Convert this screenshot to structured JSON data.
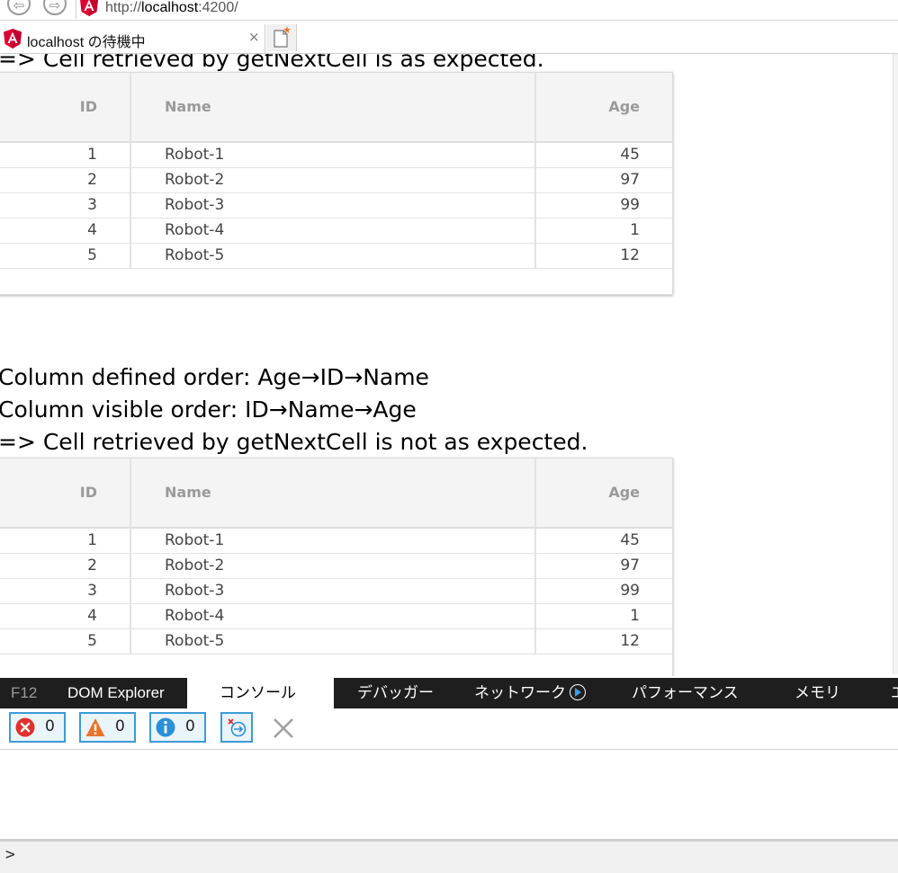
{
  "browser": {
    "url_prefix": "http://",
    "url_host": "localhost",
    "url_suffix": ":4200/",
    "tab_title": "localhost の待機中",
    "tab_close": "×"
  },
  "section1": {
    "partial_line": "=> Cell retrieved by getNextCell is as expected."
  },
  "section2": {
    "line1": "Column defined order: Age→ID→Name",
    "line2": "Column visible order: ID→Name→Age",
    "line3": "=> Cell retrieved by getNextCell is not as expected."
  },
  "grid": {
    "columns": [
      "ID",
      "Name",
      "Age"
    ],
    "rows": [
      {
        "id": "1",
        "name": "Robot-1",
        "age": "45"
      },
      {
        "id": "2",
        "name": "Robot-2",
        "age": "97"
      },
      {
        "id": "3",
        "name": "Robot-3",
        "age": "99"
      },
      {
        "id": "4",
        "name": "Robot-4",
        "age": "1"
      },
      {
        "id": "5",
        "name": "Robot-5",
        "age": "12"
      }
    ]
  },
  "devtools": {
    "tabs": [
      "F12",
      "DOM Explorer",
      "コンソール",
      "デバッガー",
      "ネットワーク",
      "パフォーマンス",
      "メモリ",
      "エ"
    ],
    "active_tab": "コンソール",
    "errors": "0",
    "warnings": "0",
    "info": "0",
    "prompt": ">"
  },
  "colors": {
    "accent": "#3c9bd6",
    "angular_red": "#dd0031",
    "error_red": "#e0302d",
    "warning_orange": "#e8742c",
    "info_blue": "#2a8fd8"
  },
  "icons": [
    "back-arrow-icon",
    "forward-arrow-icon",
    "angular-logo-icon",
    "close-icon",
    "new-tab-icon",
    "network-record-icon",
    "error-icon",
    "warning-icon",
    "info-icon",
    "clear-on-navigate-icon",
    "clear-console-icon",
    "prompt-chevron-icon"
  ]
}
